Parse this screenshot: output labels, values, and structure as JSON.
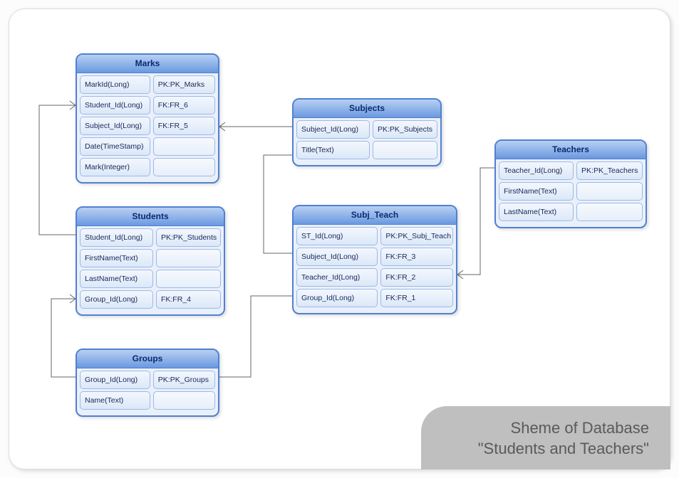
{
  "title_line1": "Sheme of Database",
  "title_line2": "\"Students and Teachers\"",
  "entities": {
    "marks": {
      "title": "Marks",
      "rows": [
        {
          "field": "MarkId(Long)",
          "key": "PK:PK_Marks"
        },
        {
          "field": "Student_Id(Long)",
          "key": "FK:FR_6"
        },
        {
          "field": "Subject_Id(Long)",
          "key": "FK:FR_5"
        },
        {
          "field": "Date(TimeStamp)",
          "key": ""
        },
        {
          "field": "Mark(Integer)",
          "key": ""
        }
      ]
    },
    "subjects": {
      "title": "Subjects",
      "rows": [
        {
          "field": "Subject_Id(Long)",
          "key": "PK:PK_Subjects"
        },
        {
          "field": "Title(Text)",
          "key": ""
        }
      ]
    },
    "teachers": {
      "title": "Teachers",
      "rows": [
        {
          "field": "Teacher_Id(Long)",
          "key": "PK:PK_Teachers"
        },
        {
          "field": "FirstName(Text)",
          "key": ""
        },
        {
          "field": "LastName(Text)",
          "key": ""
        }
      ]
    },
    "students": {
      "title": "Students",
      "rows": [
        {
          "field": "Student_Id(Long)",
          "key": "PK:PK_Students"
        },
        {
          "field": "FirstName(Text)",
          "key": ""
        },
        {
          "field": "LastName(Text)",
          "key": ""
        },
        {
          "field": "Group_Id(Long)",
          "key": "FK:FR_4"
        }
      ]
    },
    "subj_teach": {
      "title": "Subj_Teach",
      "rows": [
        {
          "field": "ST_Id(Long)",
          "key": "PK:PK_Subj_Teach"
        },
        {
          "field": "Subject_Id(Long)",
          "key": "FK:FR_3"
        },
        {
          "field": "Teacher_Id(Long)",
          "key": "FK:FR_2"
        },
        {
          "field": "Group_Id(Long)",
          "key": "FK:FR_1"
        }
      ]
    },
    "groups": {
      "title": "Groups",
      "rows": [
        {
          "field": "Group_Id(Long)",
          "key": "PK:PK_Groups"
        },
        {
          "field": "Name(Text)",
          "key": ""
        }
      ]
    }
  },
  "relationships": [
    {
      "from": "marks.Student_Id",
      "to": "students.Student_Id",
      "fk": "FR_6"
    },
    {
      "from": "marks.Subject_Id",
      "to": "subjects.Subject_Id",
      "fk": "FR_5"
    },
    {
      "from": "students.Group_Id",
      "to": "groups.Group_Id",
      "fk": "FR_4"
    },
    {
      "from": "subj_teach.Subject_Id",
      "to": "subjects.Subject_Id",
      "fk": "FR_3"
    },
    {
      "from": "subj_teach.Teacher_Id",
      "to": "teachers.Teacher_Id",
      "fk": "FR_2"
    },
    {
      "from": "subj_teach.Group_Id",
      "to": "groups.Group_Id",
      "fk": "FR_1"
    }
  ]
}
